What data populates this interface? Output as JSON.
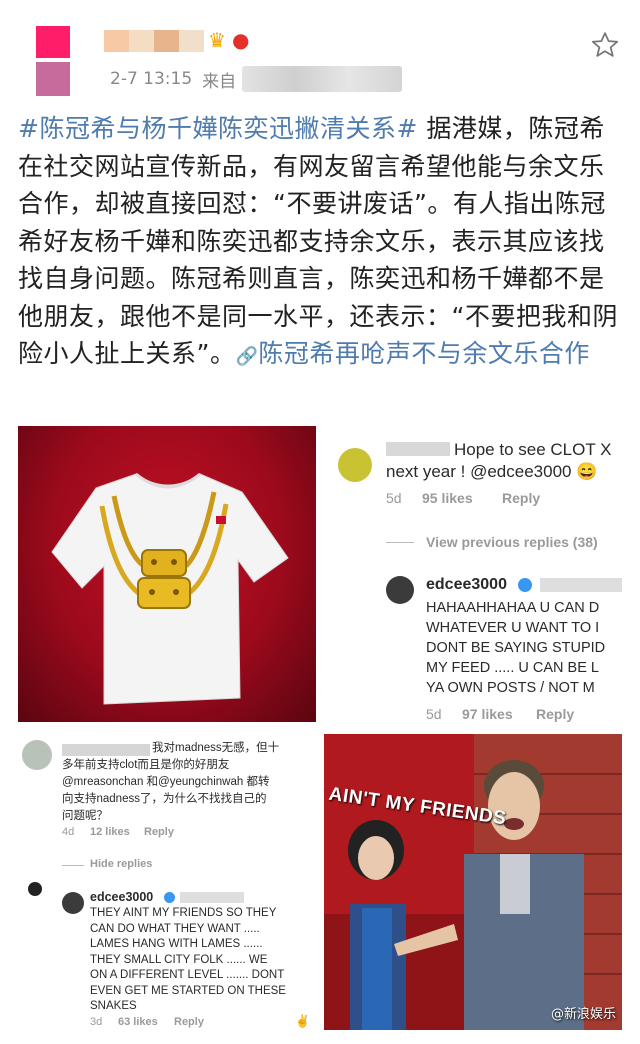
{
  "header": {
    "timestamp": "2-7 13:15",
    "source_prefix": "来自"
  },
  "post": {
    "hashtag": "#陈冠希与杨千嬅陈奕迅撇清关系#",
    "body": " 据港媒，陈冠希在社交网站宣传新品，有网友留言希望他能与余文乐合作，却被直接回怼：“不要讲废话”。有人指出陈冠希好友杨千嬅和陈奕迅都支持余文乐，表示其应该找找自身问题。陈冠希则直言，陈奕迅和杨千嬅都不是他朋友，跟他不是同一水平，还表示：“不要把我和阴险小人扯上关系”。",
    "link_icon": "🔗",
    "link_text": "陈冠希再呛声不与余文乐合作"
  },
  "image2": {
    "comment1_text": "Hope to see CLOT X",
    "comment1_text2": "next year ! @edcee3000 😄",
    "comment1_time": "5d",
    "comment1_likes": "95 likes",
    "comment1_reply": "Reply",
    "view_previous": "View previous replies (38)",
    "reply_user": "edcee3000",
    "reply_lines": [
      "HAHAAHHAHAA U CAN D",
      "WHATEVER U WANT TO I",
      "DONT BE SAYING STUPID",
      "MY FEED ..... U CAN BE L",
      "YA OWN POSTS / NOT M"
    ],
    "reply_time": "5d",
    "reply_likes": "97 likes",
    "reply_reply": "Reply"
  },
  "image3": {
    "comment_lines": [
      "我对madness无感，但十",
      "多年前支持clot而且是你的好朋友",
      "@mreasonchan 和@yeungchinwah 都转",
      "向支持nadness了，为什么不找找自己的",
      "问题呢？"
    ],
    "comment_time": "4d",
    "comment_likes": "12 likes",
    "comment_reply": "Reply",
    "hide_replies": "Hide replies",
    "reply_user": "edcee3000",
    "reply_lines": [
      "THEY AINT MY FRIENDS SO THEY",
      "CAN DO WHAT THEY WANT .....",
      "LAMES HANG WITH LAMES ......",
      "THEY SMALL CITY FOLK ...... WE",
      "ON A DIFFERENT LEVEL ....... DONT",
      "EVEN GET ME STARTED ON THESE",
      "SNAKES"
    ],
    "reply_time": "3d",
    "reply_likes": "63 likes",
    "reply_reply": "Reply"
  },
  "image4": {
    "caption": "AIN'T MY FRIENDS",
    "watermark": "@新浪娱乐"
  },
  "colors": {
    "link": "#4f7cae",
    "badge_gold": "#f0a500",
    "badge_red": "#e3302b"
  }
}
